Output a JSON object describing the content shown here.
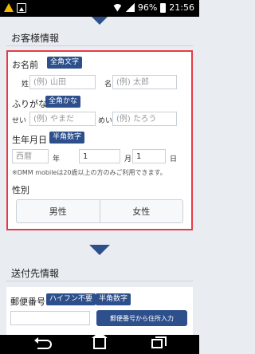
{
  "statusbar": {
    "battery": "96%",
    "time": "21:56"
  },
  "customer": {
    "section_title": "お客様情報",
    "name": {
      "label": "お名前",
      "badge": "全角文字",
      "sei_label": "姓",
      "sei_placeholder": "(例) 山田",
      "mei_label": "名",
      "mei_placeholder": "(例) 太郎"
    },
    "furigana": {
      "label": "ふりがな",
      "badge": "全角かな",
      "sei_label": "せい",
      "sei_placeholder": "(例) やまだ",
      "mei_label": "めい",
      "mei_placeholder": "(例) たろう"
    },
    "birth": {
      "label": "生年月日",
      "badge": "半角数字",
      "year_placeholder": "西暦",
      "year_unit": "年",
      "month_value": "1",
      "month_unit": "月",
      "day_value": "1",
      "day_unit": "日",
      "note": "※DMM mobileは20歳以上の方のみご利用できます。"
    },
    "gender": {
      "label": "性別",
      "male": "男性",
      "female": "女性"
    }
  },
  "shipping": {
    "section_title": "送付先情報",
    "postal_label": "郵便番号",
    "badge_hyphen": "ハイフン不要",
    "badge_num": "半角数字",
    "address_button": "郵便番号から住所入力"
  },
  "colors": {
    "accent": "#2d4f8c",
    "highlight_border": "#e53b47"
  }
}
